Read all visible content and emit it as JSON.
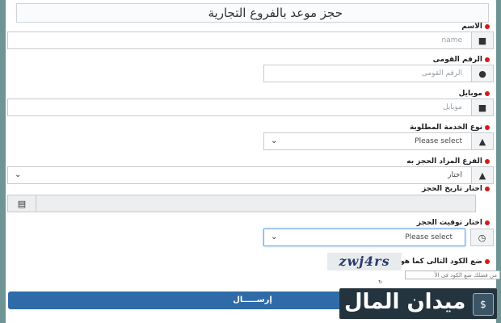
{
  "title": "حجز موعد بالفروع التجارية",
  "fields": {
    "name": {
      "label": "الاسم",
      "placeholder": "name"
    },
    "national_id": {
      "label": "الرقم القومى",
      "placeholder": "الرقم القومى"
    },
    "mobile": {
      "label": "موبايل",
      "placeholder": "موبايل"
    },
    "service": {
      "label": "نوع الخدمة المطلوبة",
      "value": "Please select"
    },
    "branch": {
      "label": "الفرع المراد الحجز به",
      "value": "اختار"
    },
    "date": {
      "label": "اختار تاريخ الحجز"
    },
    "time": {
      "label": "اختار توقيت الحجز",
      "value": "Please select"
    }
  },
  "captcha": {
    "label": "ضع الكود التالى كما هو",
    "text": "zwj4rs",
    "input_placeholder": "من فضلك ضع الكود فى الأ"
  },
  "submit_label": "إرســـــال",
  "watermark": "ميدان المال",
  "icons": {
    "name": "user-icon",
    "national_id": "map-marker-icon",
    "mobile": "user-icon",
    "service": "road-icon",
    "branch": "road-icon",
    "date": "calendar-icon",
    "time": "clock-icon"
  }
}
